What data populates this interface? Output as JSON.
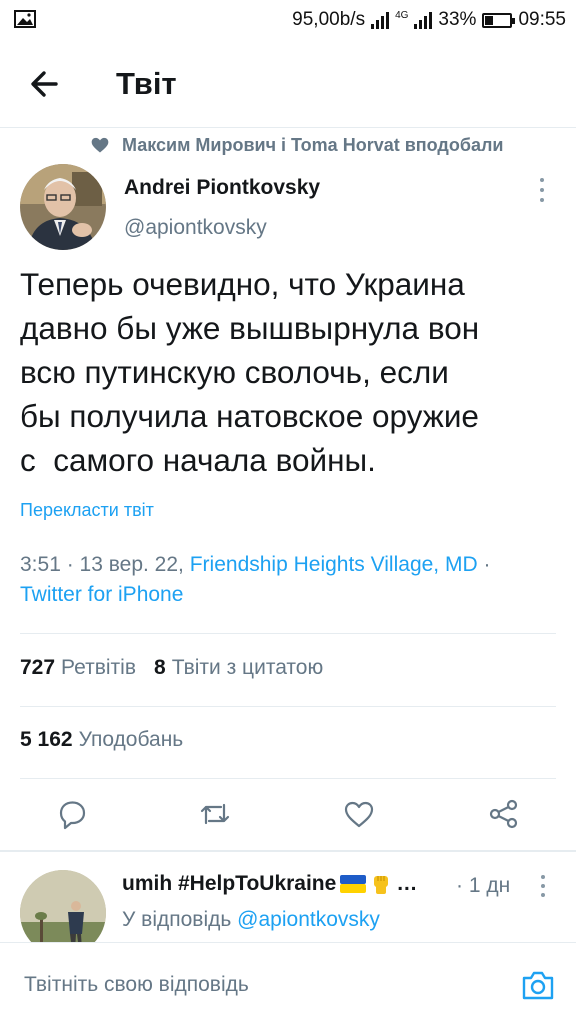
{
  "status_bar": {
    "speed": "95,00b/s",
    "network": "4G",
    "battery": "33%",
    "battery_level": 0.33,
    "time": "09:55"
  },
  "header": {
    "title": "Твіт"
  },
  "liked_by": "Максим Мирович і Toma Horvat вподобали",
  "tweet": {
    "author_name": "Andrei Piontkovsky",
    "author_handle": "@apiontkovsky",
    "text_lines": [
      "Теперь очевидно, что Украина",
      "давно бы уже вышвырнула вон",
      "всю путинскую сволочь, если",
      "бы получила натовское оружие",
      "с  самого начала войны."
    ],
    "translate_label": "Перекласти твіт",
    "time_date": "3:51 · 13 вер. 22,",
    "location": "Friendship Heights Village, MD",
    "separator": "·",
    "source": "Twitter for iPhone",
    "retweets_count": "727",
    "retweets_label": "Ретвітів",
    "quotes_count": "8",
    "quotes_label": "Твіти з цитатою",
    "likes_count": "5 162",
    "likes_label": "Уподобань"
  },
  "actions": [
    "reply-icon",
    "retweet-icon",
    "like-icon",
    "share-icon"
  ],
  "reply": {
    "author_name": "umih #HelpToUkraine",
    "name_suffix": "…",
    "time": "· 1 дн",
    "reply_to_label": "У відповідь",
    "reply_to_handle": "@apiontkovsky"
  },
  "compose": {
    "placeholder": "Твітніть свою відповідь"
  },
  "colors": {
    "accent": "#1da1f2",
    "secondary_text": "#657786",
    "primary_text": "#14171a",
    "divider": "#e6ecf0"
  }
}
